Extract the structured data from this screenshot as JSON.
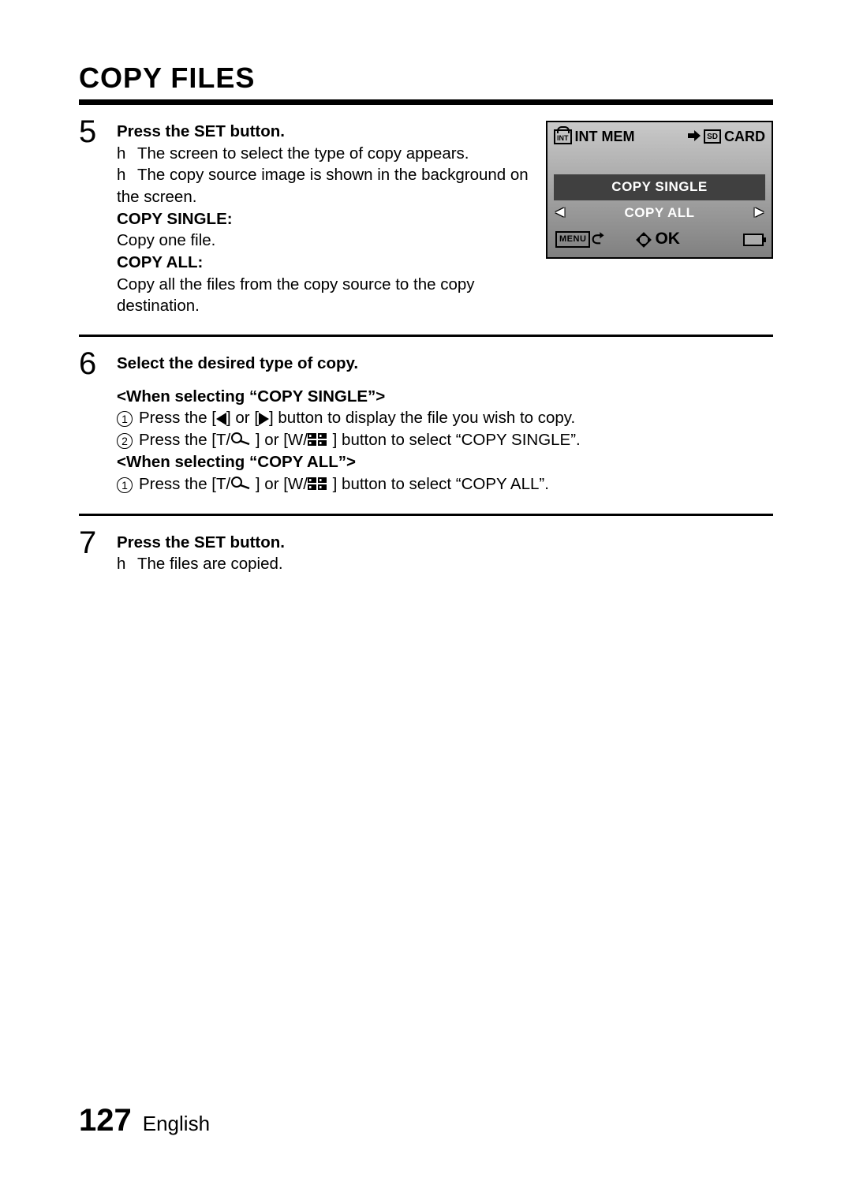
{
  "title": "COPY FILES",
  "steps": {
    "s5": {
      "num": "5",
      "head": "Press the SET button.",
      "b1_prefix": "h",
      "b1": "The screen to select the type of copy appears.",
      "b2_prefix": "h",
      "b2": "The copy source image is shown in the background on the screen.",
      "cs_label": "COPY SINGLE:",
      "cs_desc": "Copy one file.",
      "ca_label": "COPY ALL:",
      "ca_desc": "Copy all the files from the copy source to the copy destination."
    },
    "s6": {
      "num": "6",
      "head": "Select the desired type of copy.",
      "when1": "<When selecting “COPY SINGLE”>",
      "l1a": "Press the [",
      "l1b": "] or [",
      "l1c": "] button to display the file you wish to copy.",
      "l2a": "Press the [T/",
      "l2b": " ] or [W/",
      "l2c": " ] button to select “COPY SINGLE”.",
      "when2": "<When selecting “COPY ALL”>",
      "l3a": "Press the [T/",
      "l3b": " ] or [W/",
      "l3c": " ] button to select “COPY ALL”."
    },
    "s7": {
      "num": "7",
      "head": "Press the SET button.",
      "b1_prefix": "h",
      "b1": "The files are copied."
    }
  },
  "screen": {
    "src_label": "INT MEM",
    "dst_label": "CARD",
    "opt1": "COPY SINGLE",
    "opt2": "COPY ALL",
    "menu": "MENU",
    "ok": "OK"
  },
  "footer": {
    "page": "127",
    "lang": "English"
  }
}
